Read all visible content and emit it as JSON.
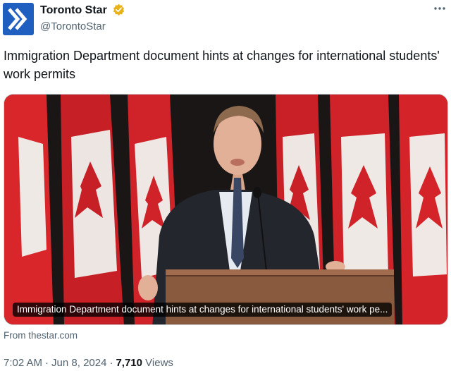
{
  "author": {
    "display_name": "Toronto Star",
    "handle": "@TorontoStar",
    "avatar_icon": "toronto-star-logo-icon",
    "verified_icon": "verified-badge-icon",
    "brand_color": "#1f5fbf",
    "verified_color": "#e8b21a"
  },
  "menu_icon": "more-options-icon",
  "tweet": {
    "text": "Immigration Department document hints at changes for international students' work permits"
  },
  "media": {
    "caption": "Immigration Department document hints at changes for international students' work pe...",
    "source": "From thestar.com"
  },
  "meta": {
    "time": "7:02 AM",
    "date": "Jun 8, 2024",
    "views_count": "7,710",
    "views_label": "Views"
  }
}
